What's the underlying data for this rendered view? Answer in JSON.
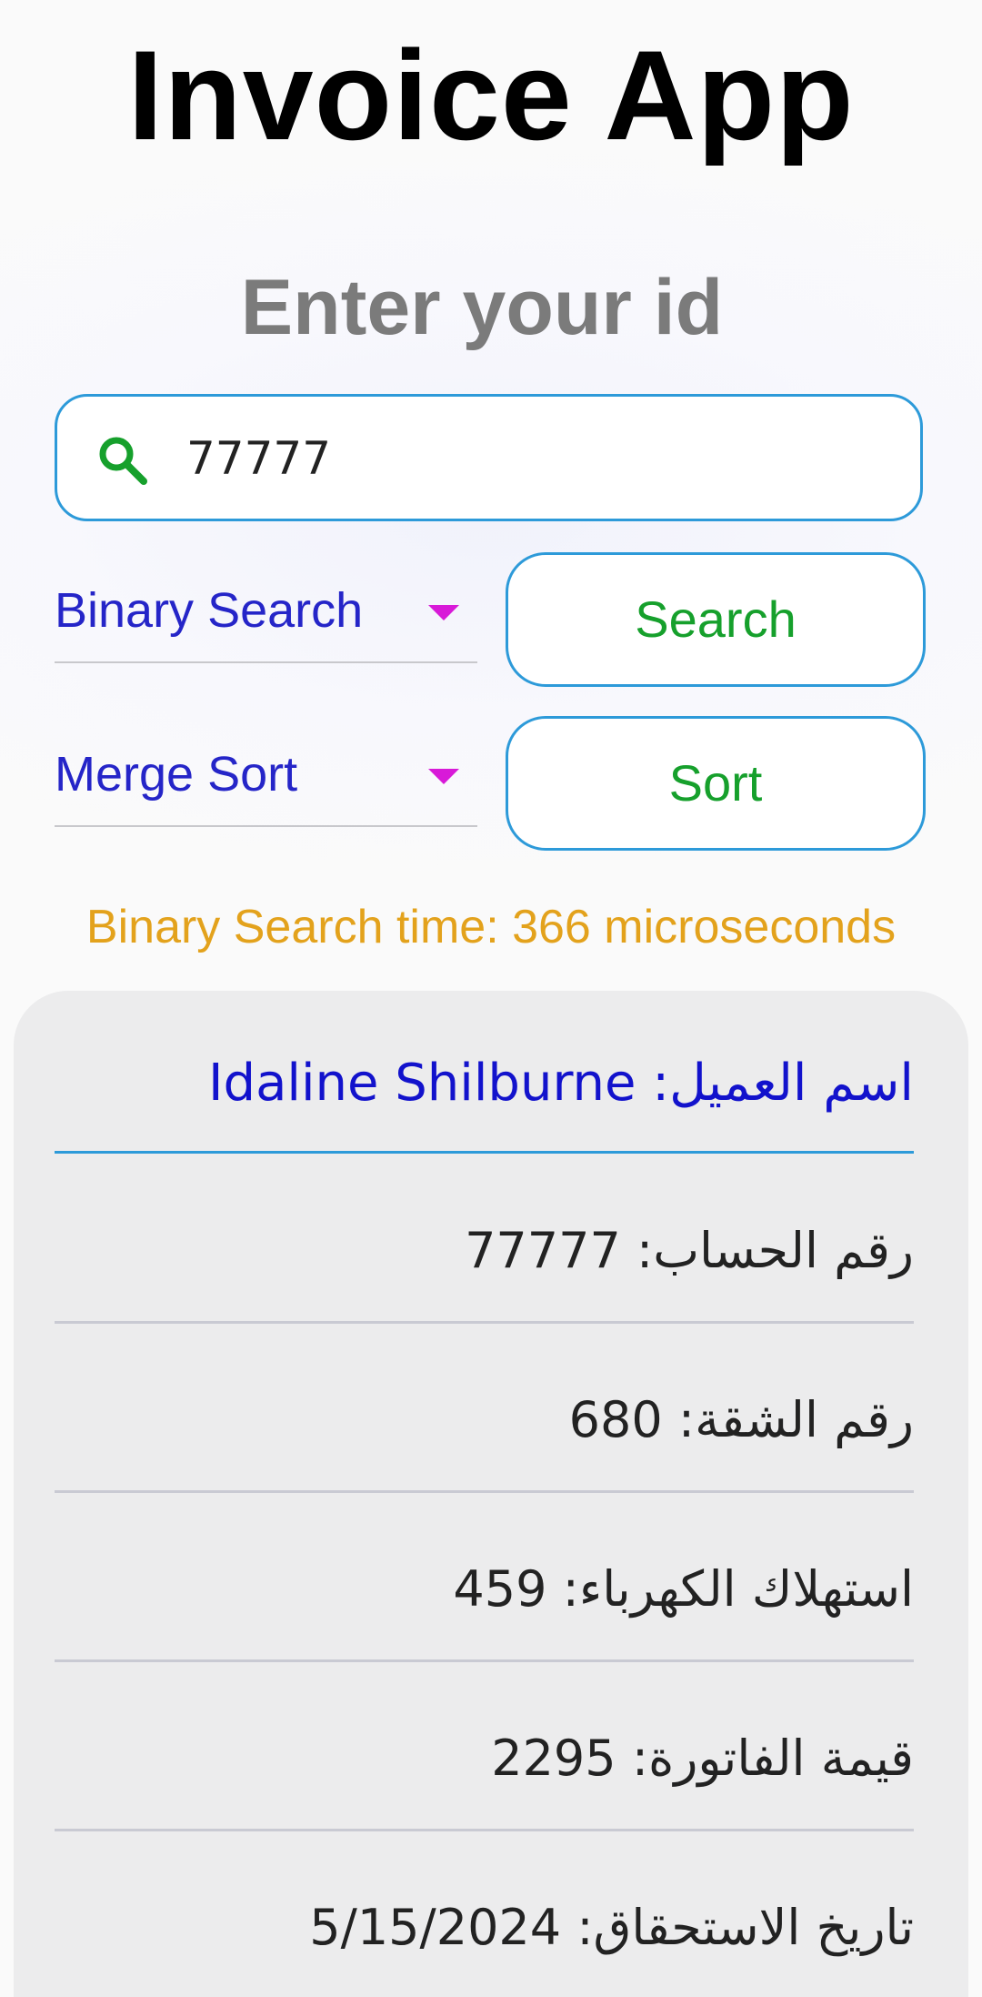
{
  "app": {
    "title": "Invoice App"
  },
  "search": {
    "prompt": "Enter your id",
    "value": "77777",
    "placeholder": ""
  },
  "search_algorithm": {
    "selected": "Binary Search"
  },
  "sort_algorithm": {
    "selected": "Merge Sort"
  },
  "buttons": {
    "search_label": "Search",
    "sort_label": "Sort"
  },
  "timing_text": "Binary Search time: 366 microseconds",
  "invoice": {
    "customer_label": "اسم العميل:",
    "customer_name": "Idaline Shilburne",
    "account_label": "رقم الحساب:",
    "account_number": "77777",
    "apartment_label": "رقم الشقة:",
    "apartment_number": "680",
    "consumption_label": "استهلاك الكهرباء:",
    "consumption": "459",
    "amount_label": "قيمة الفاتورة:",
    "amount": "2295",
    "due_label": "تاريخ الاستحقاق:",
    "due_date": "5/15/2024"
  },
  "colors": {
    "accent_border": "#2d9ad9",
    "button_text": "#16a02c",
    "dropdown_text": "#2525c8",
    "dropdown_arrow": "#d81ad8",
    "timing_text": "#e3a21c",
    "customer_text": "#1212cc",
    "card_bg": "#ececed"
  },
  "icons": {
    "search": "search-icon",
    "dropdown": "triangle-down-icon"
  }
}
